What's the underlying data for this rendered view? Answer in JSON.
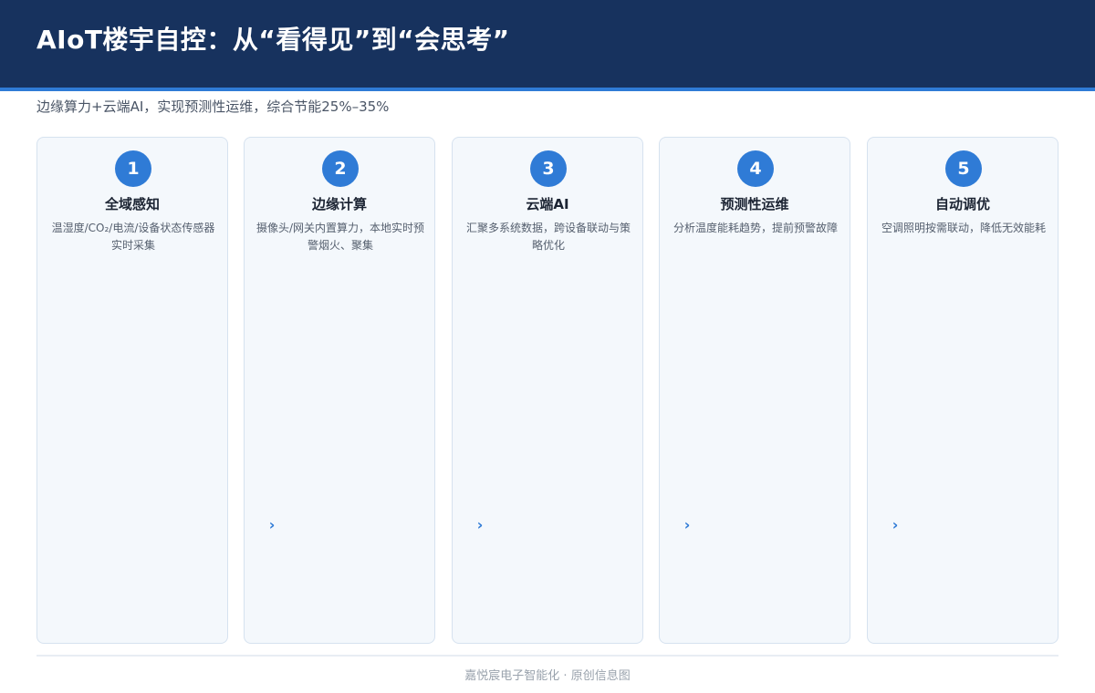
{
  "header": {
    "title": "AIoT楼宇自控：从“看得见”到“会思考”"
  },
  "subtitle": "边缘算力+云端AI，实现预测性运维，综合节能25%–35%",
  "steps": [
    {
      "number": "1",
      "title": "全域感知",
      "description": "温湿度/CO₂/电流/设备状态传感器实时采集"
    },
    {
      "number": "2",
      "title": "边缘计算",
      "description": "摄像头/网关内置算力，本地实时预警烟火、聚集"
    },
    {
      "number": "3",
      "title": "云端AI",
      "description": "汇聚多系统数据，跨设备联动与策略优化"
    },
    {
      "number": "4",
      "title": "预测性运维",
      "description": "分析温度能耗趋势，提前预警故障"
    },
    {
      "number": "5",
      "title": "自动调优",
      "description": "空调照明按需联动，降低无效能耗"
    }
  ],
  "arrow_glyph": "›",
  "footer": "嘉悦宸电子智能化 · 原创信息图",
  "colors": {
    "header_bg": "#17325e",
    "accent": "#2f7bd6",
    "card_bg": "#f4f8fc",
    "card_border": "#d6e2ef"
  }
}
